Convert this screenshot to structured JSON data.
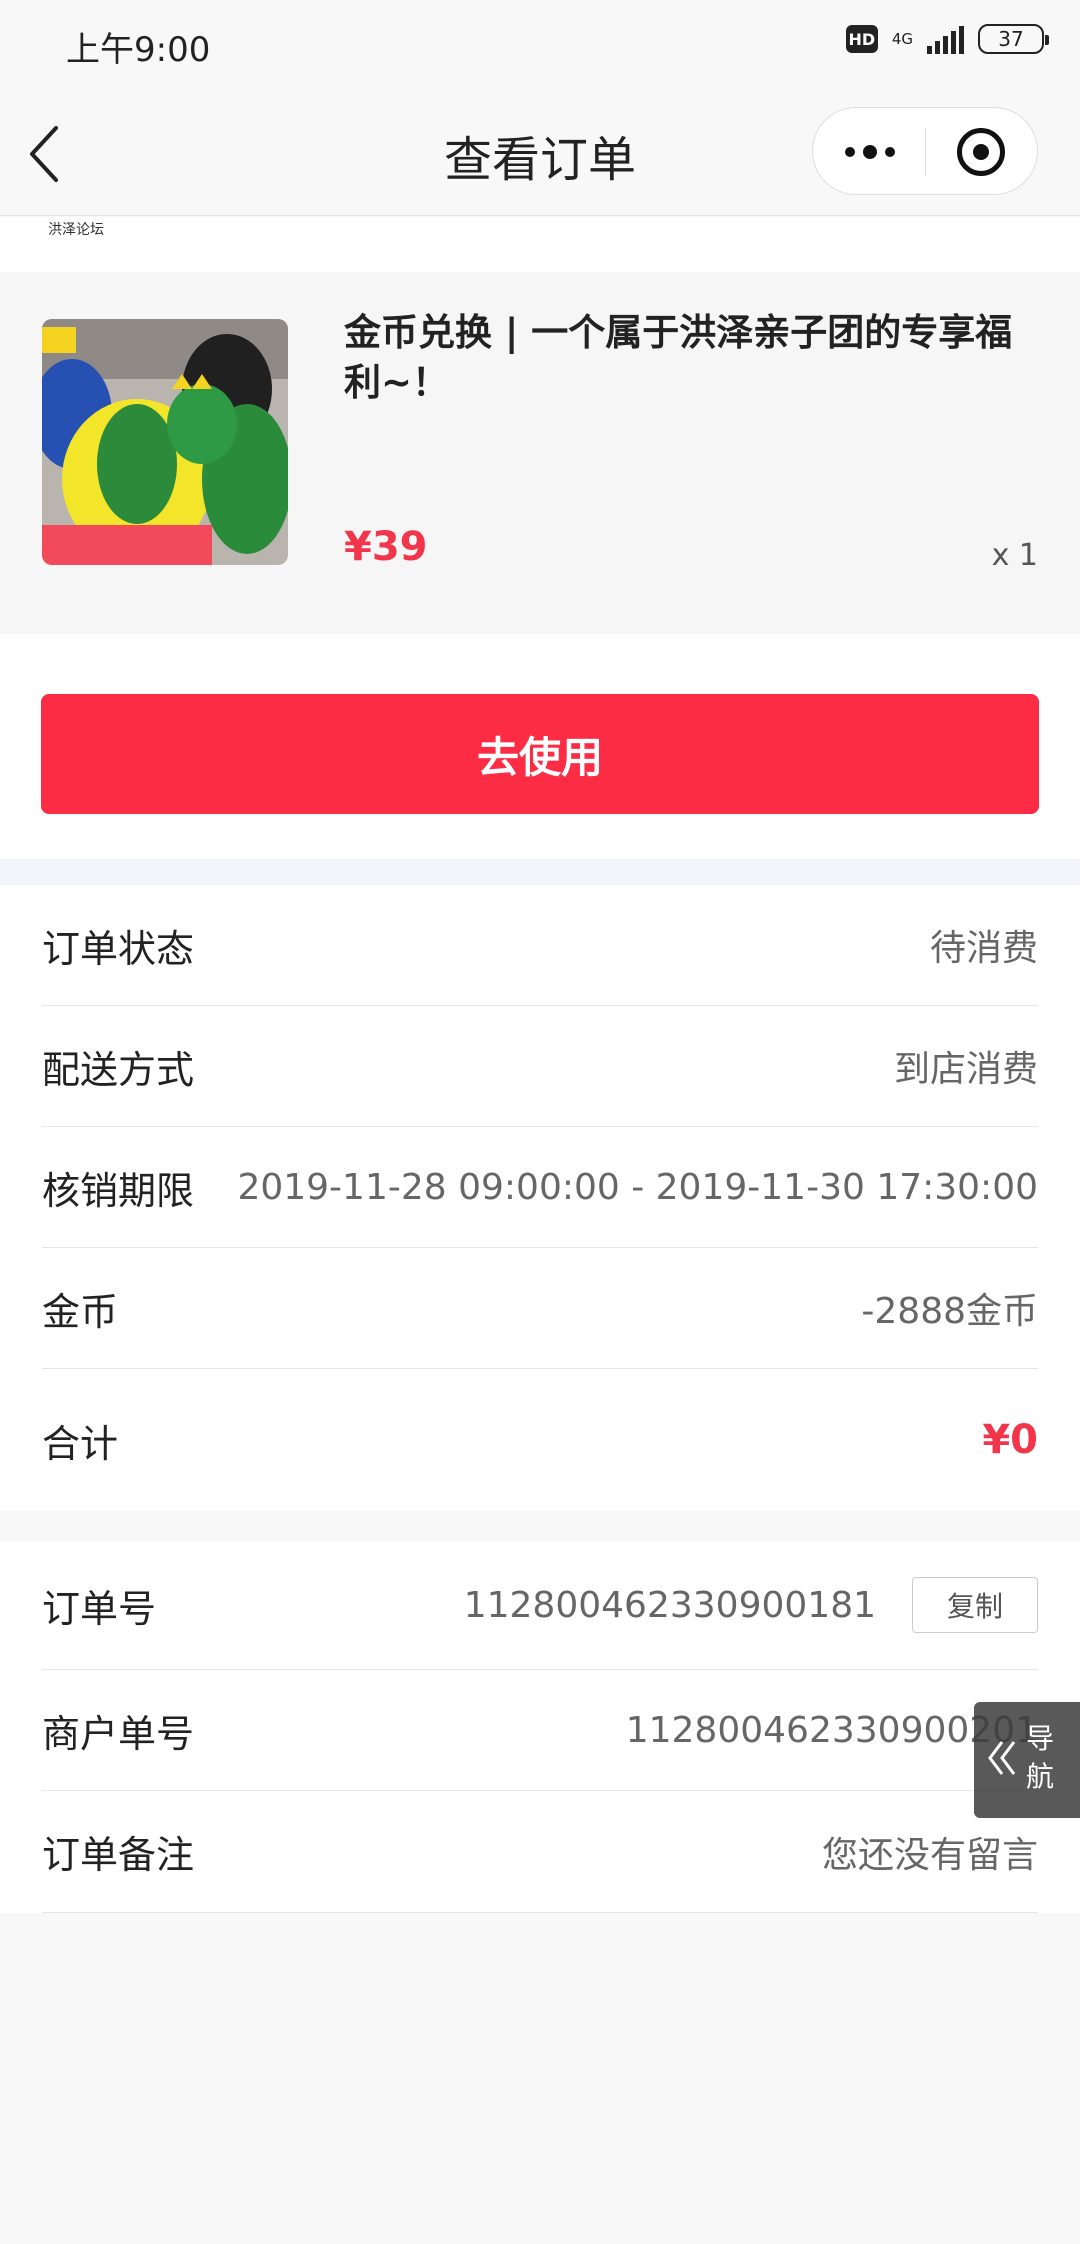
{
  "status_bar": {
    "time": "上午9:00",
    "hd": "HD",
    "network": "4G",
    "battery": "37"
  },
  "nav": {
    "title": "查看订单"
  },
  "logo": {
    "text": "洪泽论坛"
  },
  "product": {
    "title": "金币兑换 | 一个属于洪泽亲子团的专享福利~！",
    "price": "¥39",
    "quantity": "x 1"
  },
  "actions": {
    "use_label": "去使用"
  },
  "order_info": {
    "rows": [
      {
        "label": "订单状态",
        "value": "待消费"
      },
      {
        "label": "配送方式",
        "value": "到店消费"
      },
      {
        "label": "核销期限",
        "value": "2019-11-28 09:00:00 - 2019-11-30 17:30:00"
      },
      {
        "label": "金币",
        "value": "-2888金币"
      },
      {
        "label": "合计",
        "value": "¥0"
      }
    ]
  },
  "order_meta": {
    "rows": [
      {
        "label": "订单号",
        "value": "112800462330900181",
        "action": "复制"
      },
      {
        "label": "商户单号",
        "value": "112800462330900201"
      },
      {
        "label": "订单备注",
        "value": "您还没有留言"
      }
    ]
  },
  "float_nav": {
    "label_1": "导",
    "label_2": "航"
  },
  "colors": {
    "accent": "#fd2c45",
    "price": "#f2354a",
    "background": "#f8f8f8"
  }
}
